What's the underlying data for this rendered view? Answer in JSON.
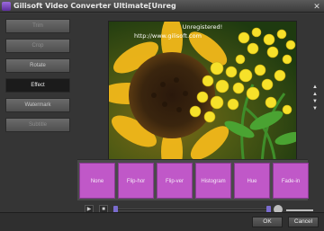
{
  "window": {
    "title": "Gilisoft Video Converter Ultimate[Unreg"
  },
  "sidebar": {
    "items": [
      {
        "label": "Trim"
      },
      {
        "label": "Crop"
      },
      {
        "label": "Rotate"
      },
      {
        "label": "Effect"
      },
      {
        "label": "Watermark"
      },
      {
        "label": "Subtitle"
      }
    ]
  },
  "preview": {
    "status_text": "Unregistered!",
    "url_text": "http://www.gilisoft.com"
  },
  "effects": {
    "tiles": [
      {
        "label": "None"
      },
      {
        "label": "Flip-hor"
      },
      {
        "label": "Flip-ver"
      },
      {
        "label": "Histogram"
      },
      {
        "label": "Hue"
      },
      {
        "label": "Fade-in"
      }
    ]
  },
  "player": {
    "play_label": "▶",
    "stop_label": "■"
  },
  "footer": {
    "ok_label": "OK",
    "cancel_label": "Cancel"
  },
  "icons": {
    "close": "close-icon",
    "play": "play-icon",
    "stop": "stop-icon",
    "volume": "volume-icon",
    "scroll_up": "triangle-up-icon",
    "scroll_down": "triangle-down-icon"
  },
  "colors": {
    "effect_tile": "#c058c8",
    "active_sidebar": "#1b1b1b",
    "slider_thumb": "#7a6ccf"
  }
}
